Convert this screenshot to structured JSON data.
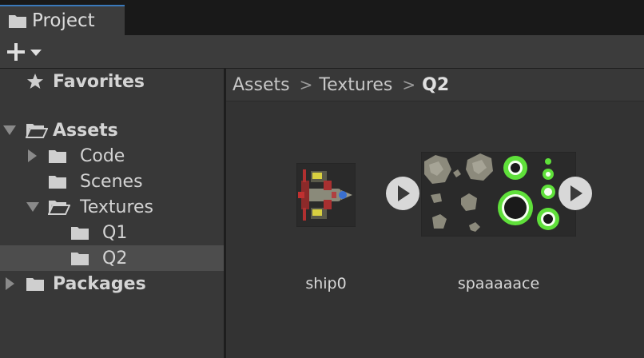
{
  "window": {
    "tab_title": "Project",
    "tab_icon": "folder-icon"
  },
  "toolbar": {
    "create_icon": "plus-icon",
    "dropdown_icon": "caret-down-icon"
  },
  "tree": {
    "favorites": "Favorites",
    "assets": "Assets",
    "code": "Code",
    "scenes": "Scenes",
    "textures": "Textures",
    "q1": "Q1",
    "q2": "Q2",
    "packages": "Packages",
    "selected": "Q2"
  },
  "breadcrumb": {
    "items": [
      "Assets",
      "Textures",
      "Q2"
    ],
    "separator": ">"
  },
  "assets": [
    {
      "name": "ship0",
      "type": "sprite"
    },
    {
      "name": "spaaaaace",
      "type": "sprite-sheet"
    }
  ],
  "colors": {
    "accent": "#3a79bb",
    "selected_row": "#4d4d4d",
    "sprite_green": "#5fe03a"
  }
}
